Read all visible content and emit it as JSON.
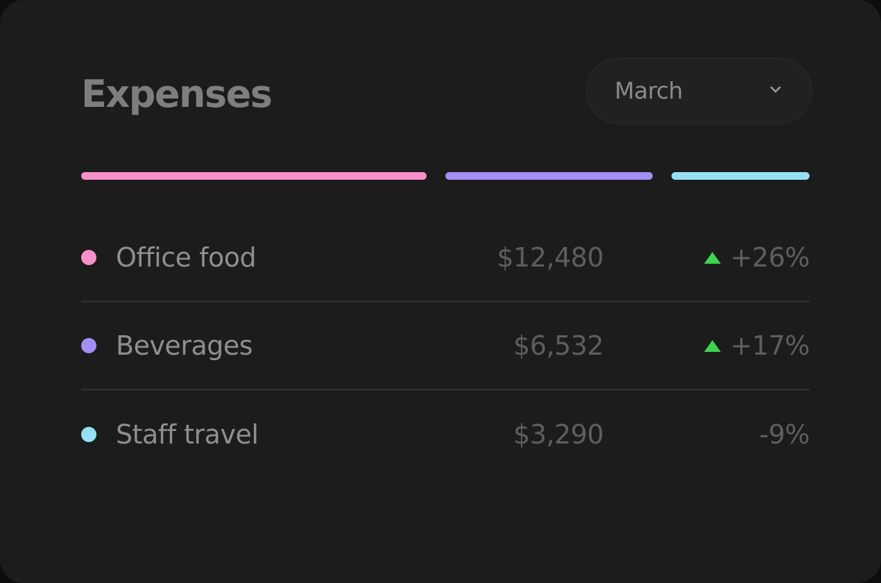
{
  "card": {
    "title": "Expenses",
    "month_selector": {
      "selected": "March",
      "icon": "chevron-down-icon"
    }
  },
  "distribution": [
    {
      "category": "Office food",
      "color": "#f790c9",
      "fraction": 0.5
    },
    {
      "category": "Beverages",
      "color": "#a38ff4",
      "fraction": 0.3
    },
    {
      "category": "Staff travel",
      "color": "#96e0f5",
      "fraction": 0.2
    }
  ],
  "expenses": [
    {
      "name": "Office food",
      "amount": "$12,480",
      "change": "+26%",
      "trend": "up",
      "color": "#f790c9"
    },
    {
      "name": "Beverages",
      "amount": "$6,532",
      "change": "+17%",
      "trend": "up",
      "color": "#a38ff4"
    },
    {
      "name": "Staff travel",
      "amount": "$3,290",
      "change": "-9%",
      "trend": "down",
      "color": "#96e0f5"
    }
  ],
  "colors": {
    "card_background": "#1c1c1c",
    "trend_up": "#3ed34f"
  }
}
